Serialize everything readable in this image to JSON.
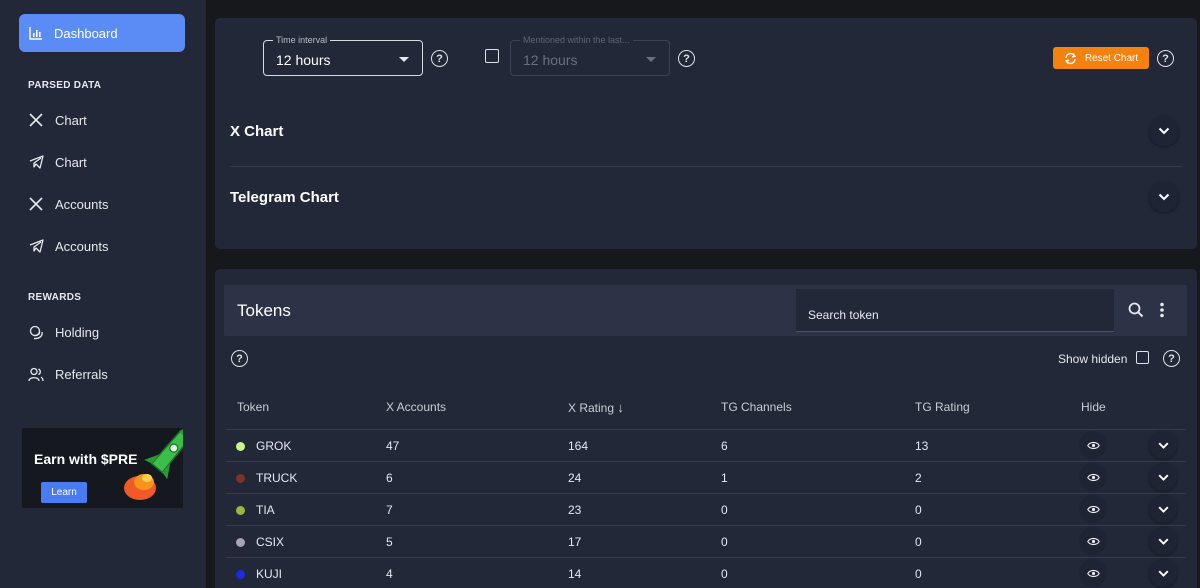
{
  "sidebar": {
    "dashboard_label": "Dashboard",
    "parsed_data_label": "PARSED DATA",
    "parsed_items": [
      {
        "label": "Chart",
        "icon": "x-logo-icon"
      },
      {
        "label": "Chart",
        "icon": "telegram-icon"
      },
      {
        "label": "Accounts",
        "icon": "x-logo-icon"
      },
      {
        "label": "Accounts",
        "icon": "telegram-icon"
      }
    ],
    "rewards_label": "REWARDS",
    "reward_items": [
      {
        "label": "Holding",
        "icon": "coins-icon"
      },
      {
        "label": "Referrals",
        "icon": "users-icon"
      }
    ],
    "promo": {
      "title": "Earn with $PRE",
      "button": "Learn"
    }
  },
  "filters": {
    "time_interval": {
      "legend": "Time interval",
      "value": "12 hours"
    },
    "mentioned": {
      "legend": "Mentioned within the last...",
      "value": "12 hours",
      "enabled": false
    },
    "reset_label": "Reset Chart"
  },
  "accordions": [
    {
      "title": "X Chart"
    },
    {
      "title": "Telegram Chart"
    }
  ],
  "tokens": {
    "title": "Tokens",
    "search_placeholder": "Search token",
    "show_hidden_label": "Show hidden",
    "columns": [
      "Token",
      "X Accounts",
      "X Rating",
      "TG Channels",
      "TG Rating",
      "Hide"
    ],
    "sort_indicator": "↓",
    "rows": [
      {
        "token": "GROK",
        "dot_color": "#c8f58a",
        "x_accounts": "47",
        "x_rating": "164",
        "tg_channels": "6",
        "tg_rating": "13"
      },
      {
        "token": "TRUCK",
        "dot_color": "#7a3524",
        "x_accounts": "6",
        "x_rating": "24",
        "tg_channels": "1",
        "tg_rating": "2"
      },
      {
        "token": "TIA",
        "dot_color": "#9ab83a",
        "x_accounts": "7",
        "x_rating": "23",
        "tg_channels": "0",
        "tg_rating": "0"
      },
      {
        "token": "CSIX",
        "dot_color": "#a9a2b8",
        "x_accounts": "5",
        "x_rating": "17",
        "tg_channels": "0",
        "tg_rating": "0"
      },
      {
        "token": "KUJI",
        "dot_color": "#1d2be0",
        "x_accounts": "4",
        "x_rating": "14",
        "tg_channels": "0",
        "tg_rating": "0"
      }
    ]
  },
  "colors": {
    "accent": "#5b8cf5",
    "reset": "#f4820f",
    "panel": "#232838",
    "background": "#17181c"
  }
}
